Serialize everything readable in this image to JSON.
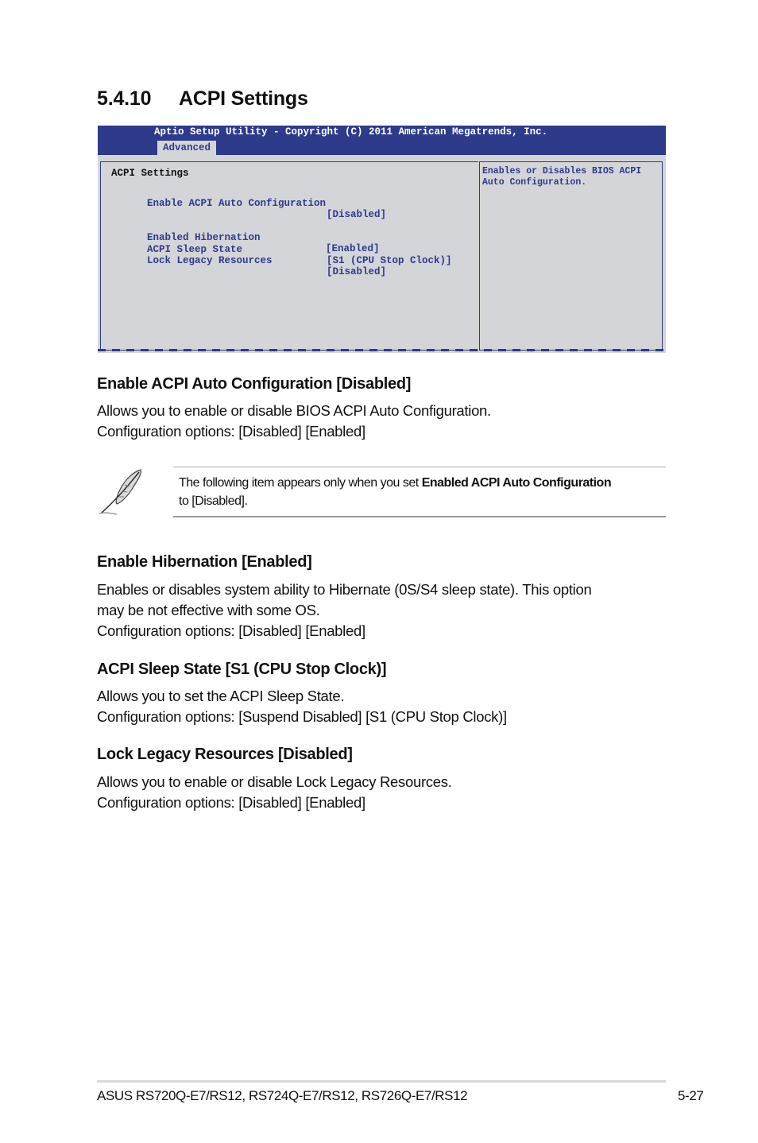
{
  "section": {
    "number": "5.4.10",
    "title": "ACPI Settings"
  },
  "bios": {
    "title_bar": "Aptio Setup Utility - Copyright (C) 2011 American Megatrends, Inc.",
    "active_tab": "Advanced",
    "heading": "ACPI Settings",
    "items": [
      {
        "label": "Enable ACPI Auto Configuration",
        "value": "[Disabled]"
      },
      {
        "label": "Enabled Hibernation",
        "value": "[Enabled]"
      },
      {
        "label": "ACPI Sleep State",
        "value": "[S1 (CPU Stop Clock)]"
      },
      {
        "label": "Lock Legacy Resources",
        "value": "[Disabled]"
      }
    ],
    "help_lines": [
      "Enables or Disables BIOS ACPI",
      "Auto Configuration."
    ],
    "colors": {
      "header_bg": "#2e3a8a",
      "panel_bg": "#d4d5d9",
      "item_text": "#2e3a8a"
    }
  },
  "items": [
    {
      "heading": "Enable ACPI Auto Configuration [Disabled]",
      "lines": [
        "Allows you to enable or disable BIOS ACPI Auto Configuration.",
        "Configuration options: [Disabled] [Enabled]"
      ]
    },
    {
      "heading": "Enable Hibernation [Enabled]",
      "lines": [
        "Enables or disables system ability to Hibernate (0S/S4 sleep state). This option",
        "may be not effective with some OS.",
        "Configuration options: [Disabled] [Enabled]"
      ]
    },
    {
      "heading": "ACPI Sleep State [S1 (CPU Stop Clock)]",
      "lines": [
        "Allows you to set the ACPI Sleep State.",
        "Configuration options: [Suspend Disabled] [S1 (CPU Stop Clock)]"
      ]
    },
    {
      "heading": "Lock Legacy Resources [Disabled]",
      "lines": [
        "Allows you to enable or disable Lock Legacy Resources.",
        "Configuration options: [Disabled] [Enabled]"
      ]
    }
  ],
  "note": {
    "icon": "feather-pen-icon",
    "text_before": "The following item appears only when you set ",
    "text_bold": "Enabled ACPI Auto Configuration",
    "text_after": "to [Disabled]."
  },
  "footer": {
    "product": "ASUS RS720Q-E7/RS12, RS724Q-E7/RS12, RS726Q-E7/RS12",
    "page": "5-27"
  }
}
